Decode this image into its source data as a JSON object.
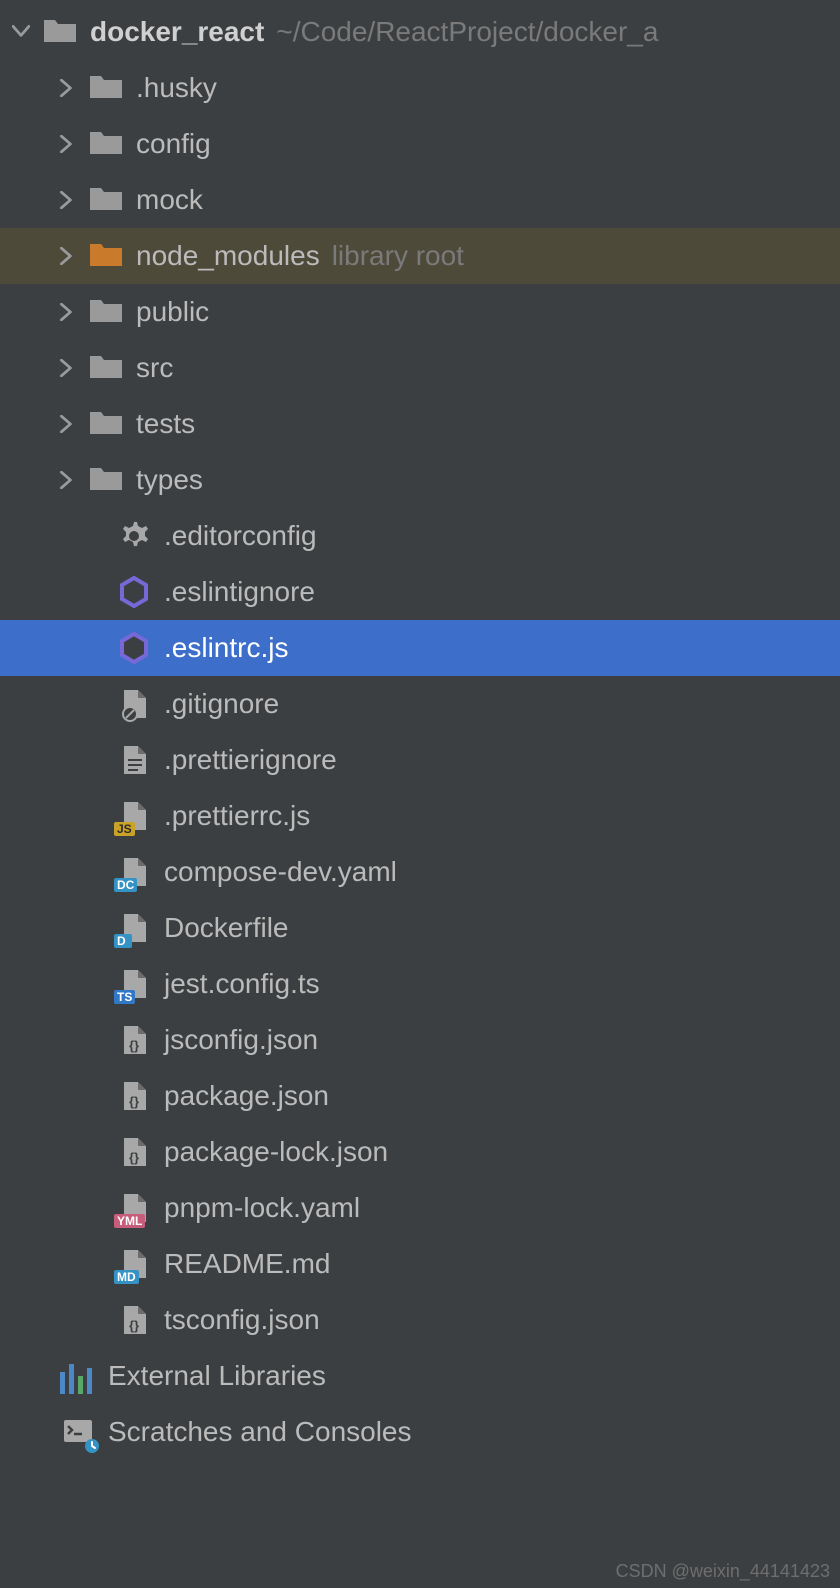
{
  "root": {
    "name": "docker_react",
    "path": "~/Code/ReactProject/docker_a"
  },
  "folders": {
    "husky": ".husky",
    "config": "config",
    "mock": "mock",
    "node_modules": "node_modules",
    "node_modules_annotation": "library root",
    "public": "public",
    "src": "src",
    "tests": "tests",
    "types": "types"
  },
  "files": {
    "editorconfig": ".editorconfig",
    "eslintignore": ".eslintignore",
    "eslintrc": ".eslintrc.js",
    "gitignore": ".gitignore",
    "prettierignore": ".prettierignore",
    "prettierrc": ".prettierrc.js",
    "compose": "compose-dev.yaml",
    "dockerfile": "Dockerfile",
    "jestconfig": "jest.config.ts",
    "jsconfig": "jsconfig.json",
    "package": "package.json",
    "packagelock": "package-lock.json",
    "pnpmlock": "pnpm-lock.yaml",
    "readme": "README.md",
    "tsconfig": "tsconfig.json"
  },
  "external": "External Libraries",
  "scratches": "Scratches and Consoles",
  "watermark": "CSDN @weixin_44141423"
}
